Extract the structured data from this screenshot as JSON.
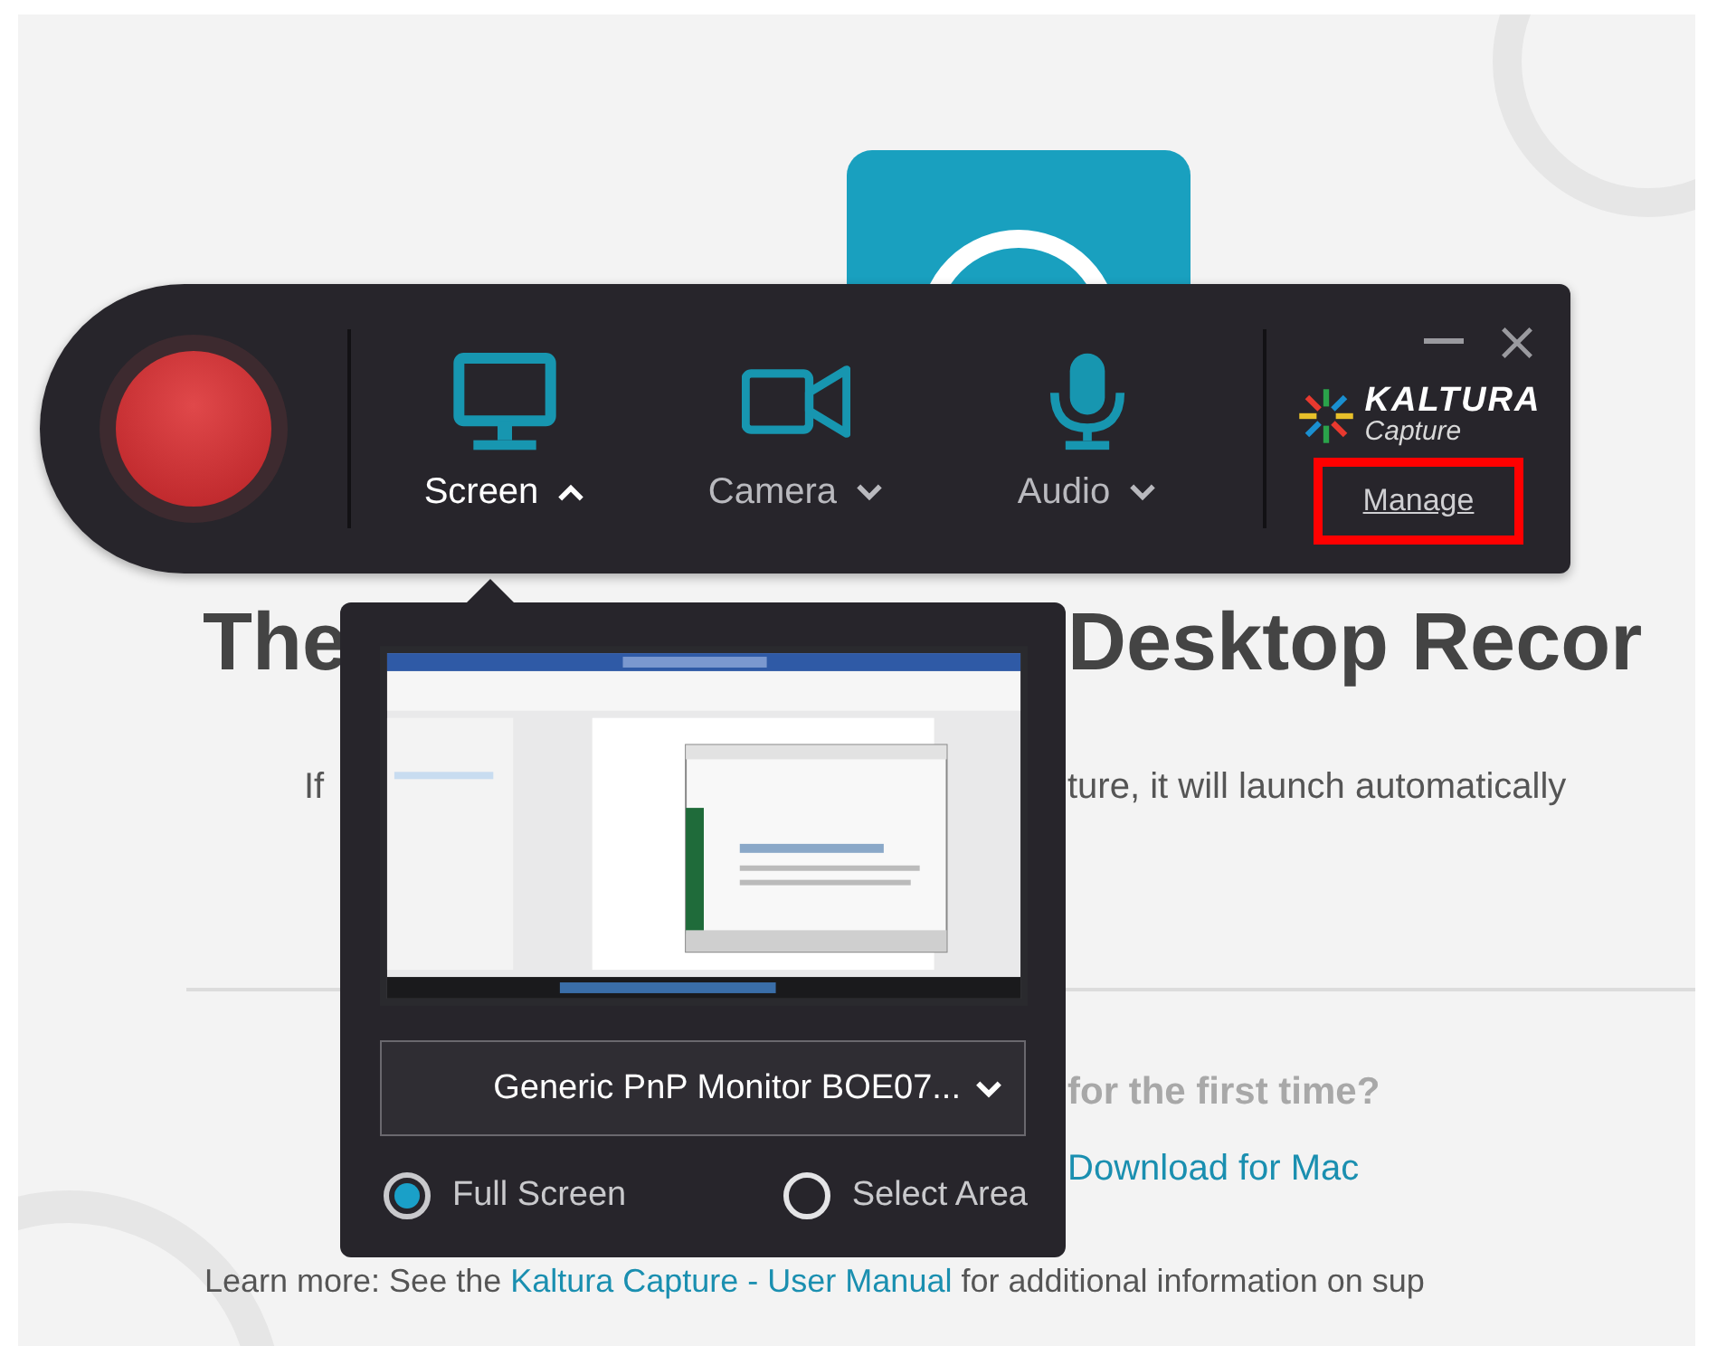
{
  "background_page": {
    "heading_parts": [
      "The",
      "Desktop Recor"
    ],
    "intro_parts": [
      "If",
      "ture, it will launch automatically"
    ],
    "first_time_prompt": "for the first time?",
    "download_link": "Download for Mac",
    "learn_more": {
      "before": "Learn more: See the ",
      "link": "Kaltura Capture - User Manual",
      "after": " for additional information on sup"
    }
  },
  "recorder": {
    "sources": [
      {
        "kind": "screen",
        "label": "Screen",
        "expanded": true
      },
      {
        "kind": "camera",
        "label": "Camera",
        "expanded": false
      },
      {
        "kind": "audio",
        "label": "Audio",
        "expanded": false
      }
    ],
    "logo": {
      "name": "KALTURA",
      "sub": "Capture"
    },
    "manage_link": "Manage",
    "manage_highlighted": true
  },
  "screen_panel": {
    "monitor": "Generic PnP Monitor BOE07...",
    "options": [
      {
        "label": "Full Screen",
        "selected": true
      },
      {
        "label": "Select Area",
        "selected": false
      }
    ]
  }
}
